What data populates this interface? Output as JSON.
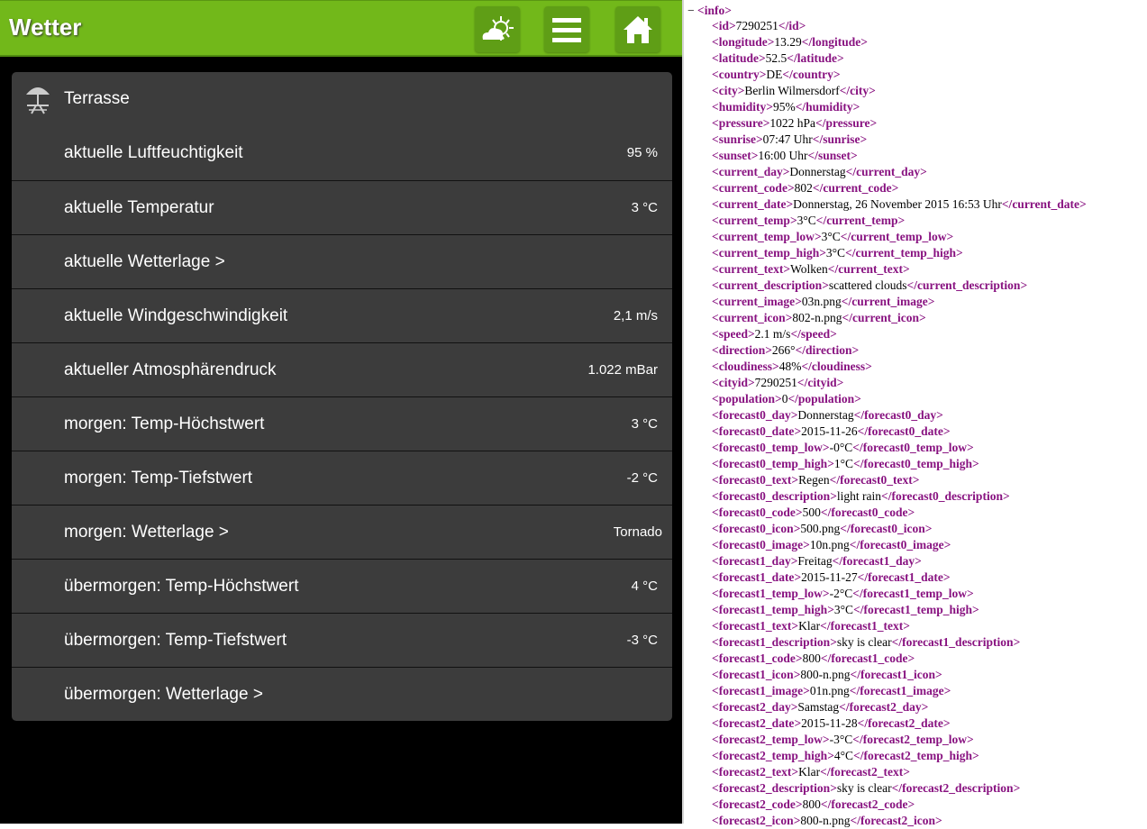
{
  "header": {
    "title": "Wetter",
    "buttons": [
      {
        "icon": "weather-icon"
      },
      {
        "icon": "menu-icon"
      },
      {
        "icon": "home-icon"
      }
    ],
    "color": "#72b81a"
  },
  "list": {
    "group": "Terrasse",
    "group_icon": "parasol-table-icon",
    "rows": [
      {
        "label": "aktuelle Luftfeuchtigkeit",
        "value": "95 %"
      },
      {
        "label": "aktuelle Temperatur",
        "value": "3 °C"
      },
      {
        "label": "aktuelle Wetterlage >",
        "value": ""
      },
      {
        "label": "aktuelle Windgeschwindigkeit",
        "value": "2,1 m/s"
      },
      {
        "label": "aktueller Atmosphärendruck",
        "value": "1.022 mBar"
      },
      {
        "label": "morgen: Temp-Höchstwert",
        "value": "3 °C"
      },
      {
        "label": "morgen: Temp-Tiefstwert",
        "value": "-2 °C"
      },
      {
        "label": "morgen: Wetterlage >",
        "value": "Tornado"
      },
      {
        "label": "übermorgen: Temp-Höchstwert",
        "value": "4 °C"
      },
      {
        "label": "übermorgen: Temp-Tiefstwert",
        "value": "-3 °C"
      },
      {
        "label": "übermorgen: Wetterlage >",
        "value": ""
      }
    ]
  },
  "xml": {
    "collapse": "−",
    "root": "info",
    "lines": [
      {
        "tag": "id",
        "value": "7290251"
      },
      {
        "tag": "longitude",
        "value": "13.29"
      },
      {
        "tag": "latitude",
        "value": "52.5"
      },
      {
        "tag": "country",
        "value": "DE"
      },
      {
        "tag": "city",
        "value": "Berlin Wilmersdorf"
      },
      {
        "tag": "humidity",
        "value": "95%"
      },
      {
        "tag": "pressure",
        "value": "1022 hPa"
      },
      {
        "tag": "sunrise",
        "value": "07:47 Uhr"
      },
      {
        "tag": "sunset",
        "value": "16:00 Uhr"
      },
      {
        "tag": "current_day",
        "value": "Donnerstag"
      },
      {
        "tag": "current_code",
        "value": "802"
      },
      {
        "tag": "current_date",
        "value": "Donnerstag, 26 November 2015 16:53 Uhr"
      },
      {
        "tag": "current_temp",
        "value": "3°C"
      },
      {
        "tag": "current_temp_low",
        "value": "3°C"
      },
      {
        "tag": "current_temp_high",
        "value": "3°C"
      },
      {
        "tag": "current_text",
        "value": "Wolken"
      },
      {
        "tag": "current_description",
        "value": "scattered clouds"
      },
      {
        "tag": "current_image",
        "value": "03n.png"
      },
      {
        "tag": "current_icon",
        "value": "802-n.png"
      },
      {
        "tag": "speed",
        "value": "2.1 m/s"
      },
      {
        "tag": "direction",
        "value": "266°"
      },
      {
        "tag": "cloudiness",
        "value": "48%"
      },
      {
        "tag": "cityid",
        "value": "7290251"
      },
      {
        "tag": "population",
        "value": "0"
      },
      {
        "tag": "forecast0_day",
        "value": "Donnerstag"
      },
      {
        "tag": "forecast0_date",
        "value": "2015-11-26"
      },
      {
        "tag": "forecast0_temp_low",
        "value": "-0°C"
      },
      {
        "tag": "forecast0_temp_high",
        "value": "1°C"
      },
      {
        "tag": "forecast0_text",
        "value": "Regen"
      },
      {
        "tag": "forecast0_description",
        "value": "light rain"
      },
      {
        "tag": "forecast0_code",
        "value": "500"
      },
      {
        "tag": "forecast0_icon",
        "value": "500.png"
      },
      {
        "tag": "forecast0_image",
        "value": "10n.png"
      },
      {
        "tag": "forecast1_day",
        "value": "Freitag"
      },
      {
        "tag": "forecast1_date",
        "value": "2015-11-27"
      },
      {
        "tag": "forecast1_temp_low",
        "value": "-2°C"
      },
      {
        "tag": "forecast1_temp_high",
        "value": "3°C"
      },
      {
        "tag": "forecast1_text",
        "value": "Klar"
      },
      {
        "tag": "forecast1_description",
        "value": "sky is clear"
      },
      {
        "tag": "forecast1_code",
        "value": "800"
      },
      {
        "tag": "forecast1_icon",
        "value": "800-n.png"
      },
      {
        "tag": "forecast1_image",
        "value": "01n.png"
      },
      {
        "tag": "forecast2_day",
        "value": "Samstag"
      },
      {
        "tag": "forecast2_date",
        "value": "2015-11-28"
      },
      {
        "tag": "forecast2_temp_low",
        "value": "-3°C"
      },
      {
        "tag": "forecast2_temp_high",
        "value": "4°C"
      },
      {
        "tag": "forecast2_text",
        "value": "Klar"
      },
      {
        "tag": "forecast2_description",
        "value": "sky is clear"
      },
      {
        "tag": "forecast2_code",
        "value": "800"
      },
      {
        "tag": "forecast2_icon",
        "value": "800-n.png"
      }
    ]
  }
}
